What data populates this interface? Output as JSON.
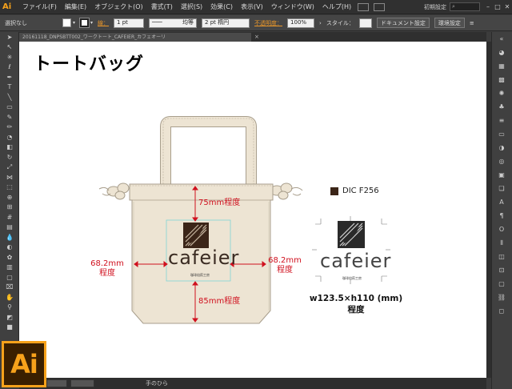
{
  "app": {
    "mini_logo": "Ai",
    "big_logo": "Ai"
  },
  "menubar": {
    "items": [
      "ファイル(F)",
      "編集(E)",
      "オブジェクト(O)",
      "書式(T)",
      "選択(S)",
      "効果(C)",
      "表示(V)",
      "ウィンドウ(W)",
      "ヘルプ(H)"
    ],
    "workspace": "初期設定",
    "min": "–",
    "max": "□",
    "close": "✕"
  },
  "controlbar": {
    "selection": "選択なし",
    "stroke_label": "線：",
    "stroke_weight": "1 pt",
    "profile": "均等",
    "brush": "2 pt 楕円",
    "opacity_label": "不透明度：",
    "opacity": "100%",
    "style_label": "スタイル：",
    "doc_setup": "ドキュメント設定",
    "prefs": "環境設定"
  },
  "tab": {
    "title": "20161118_DNPSBTT002_ワークトート_CAFEIER_カフェオーリ",
    "close": "×"
  },
  "canvas": {
    "title": "トートバッグ",
    "labels": {
      "top": "75mm程度",
      "left": "68.2mm\n程度",
      "right": "68.2mm\n程度",
      "bottom": "85mm程度"
    },
    "logo_word": "cafeier",
    "logo_tagline": "珈琲焙煎工房",
    "color_code": "DIC F256",
    "spec_line1": "w123.5×h110 (mm)",
    "spec_line2": "程度"
  },
  "statusbar": {
    "zoom": "",
    "page": "",
    "tool": "手のひら"
  },
  "colors": {
    "bag": "#ede4d3",
    "bag_stroke": "#a89e8c",
    "logo_brown": "#3b2518",
    "dimension_red": "#d0101e",
    "ai_orange": "#f7a21b"
  }
}
